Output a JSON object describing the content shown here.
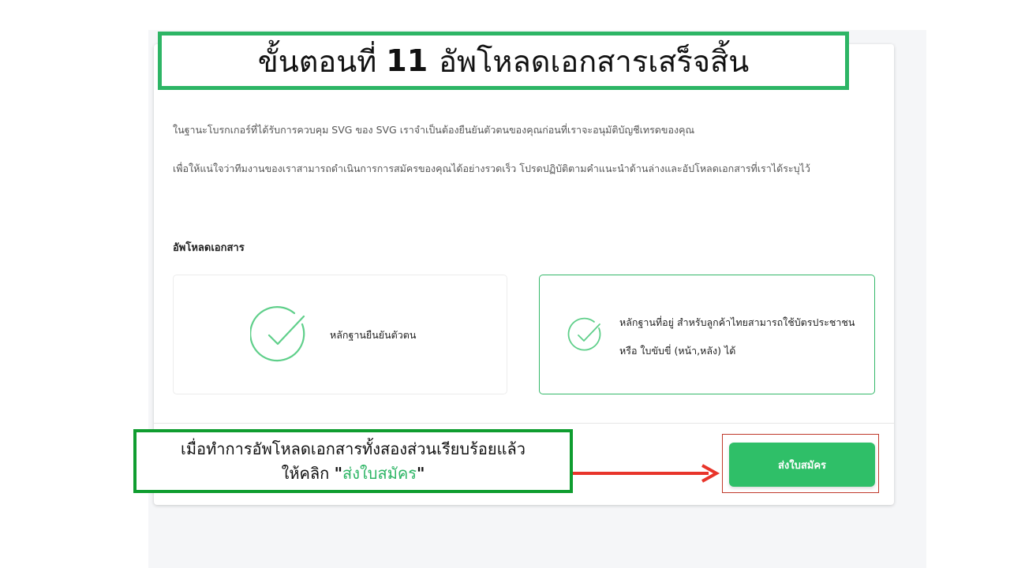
{
  "title": {
    "prefix": "ขั้นตอนที่",
    "number": "11",
    "text": "อัพโหลดเอกสารเสร็จสิ้น"
  },
  "intro": {
    "paragraph1": "ในฐานะโบรกเกอร์ที่ได้รับการควบคุม SVG ของ SVG เราจำเป็นต้องยืนยันตัวตนของคุณก่อนที่เราจะอนุมัติบัญชีเทรดของคุณ",
    "paragraph2": "เพื่อให้แน่ใจว่าทีมงานของเราสามารถดำเนินการการสมัครของคุณได้อย่างรวดเร็ว โปรดปฏิบัติตามคำแนะนำด้านล่างและอัปโหลดเอกสารที่เราได้ระบุไว้"
  },
  "upload": {
    "section_title": "อัพโหลดเอกสาร",
    "id_proof_label": "หลักฐานยืนยันตัวตน",
    "address_proof_label": "หลักฐานที่อยู่ สำหรับลูกค้าไทยสามารถใช้บัตรประชาชน หรือ ใบขับขี่ (หน้า,หลัง) ได้"
  },
  "submit_label": "ส่งใบสมัคร",
  "annotation": {
    "line1": "เมื่อทำการอัพโหลดเอกสารทั้งสองส่วนเรียบร้อยแล้ว",
    "line2_prefix": "ให้คลิก",
    "quote_open": "\"",
    "highlight": "ส่งใบสมัคร",
    "quote_close": "\""
  },
  "colors": {
    "accent_green": "#2db565",
    "button_green": "#2fbf68",
    "arrow_red": "#e8342a",
    "highlight_border": "#c0392b"
  },
  "icons": {
    "upload_status": "check-circle-icon",
    "pointer": "arrow-right-icon"
  }
}
